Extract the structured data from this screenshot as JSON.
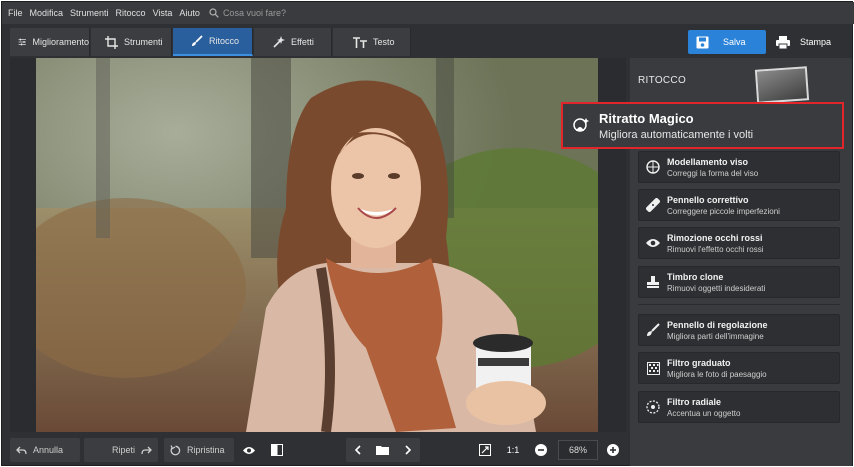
{
  "menu": [
    "File",
    "Modifica",
    "Strumenti",
    "Ritocco",
    "Vista",
    "Aiuto"
  ],
  "search": {
    "placeholder": "Cosa vuoi fare?"
  },
  "tabs": [
    {
      "label": "Miglioramento",
      "icon": "sliders-icon"
    },
    {
      "label": "Strumenti",
      "icon": "crop-icon"
    },
    {
      "label": "Ritocco",
      "icon": "brush-icon"
    },
    {
      "label": "Effetti",
      "icon": "magic-wand-icon"
    },
    {
      "label": "Testo",
      "icon": "text-icon"
    }
  ],
  "actions": {
    "save": "Salva",
    "print": "Stampa"
  },
  "panel": {
    "title": "RITOCCO",
    "highlight": {
      "name": "Ritratto Magico",
      "desc": "Migliora automaticamente i volti",
      "icon": "face-magic-icon"
    },
    "tools": [
      {
        "name": "Modellamento viso",
        "desc": "Correggi la forma del viso",
        "icon": "face-shape-icon"
      },
      {
        "name": "Pennello correttivo",
        "desc": "Correggere piccole imperfezioni",
        "icon": "bandage-icon"
      },
      {
        "name": "Rimozione occhi rossi",
        "desc": "Rimuovi l'effetto occhi rossi",
        "icon": "eye-icon"
      },
      {
        "name": "Timbro clone",
        "desc": "Rimuovi oggetti indesiderati",
        "icon": "stamp-icon"
      },
      {
        "name": "Pennello di regolazione",
        "desc": "Migliora parti dell'immagine",
        "icon": "brush-icon"
      },
      {
        "name": "Filtro graduato",
        "desc": "Migliora le foto di paesaggio",
        "icon": "gradient-filter-icon"
      },
      {
        "name": "Filtro radiale",
        "desc": "Accentua un oggetto",
        "icon": "radial-filter-icon"
      }
    ]
  },
  "bottom": {
    "undo": "Annulla",
    "redo": "Ripeti",
    "reset": "Ripristina",
    "ratio": "1:1",
    "zoom": "68%"
  },
  "colors": {
    "accent": "#2a83d9",
    "active_tab": "#2a5f9e",
    "highlight_border": "#e0262a"
  }
}
